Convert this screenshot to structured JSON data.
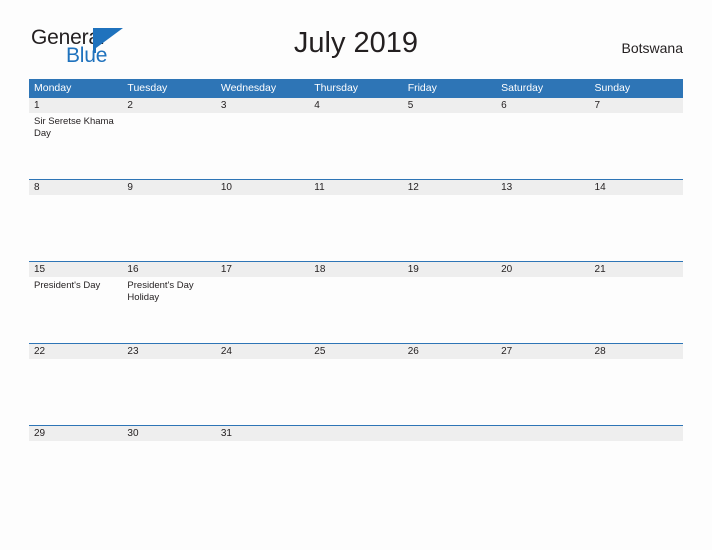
{
  "brand": {
    "name_part1": "General",
    "name_part2": "Blue",
    "flag_icon": "blue-triangle-flag-icon",
    "accent_color": "#1f72bd"
  },
  "header": {
    "title": "July 2019",
    "country": "Botswana"
  },
  "theme": {
    "header_blue": "#2e75b6",
    "number_band": "#eeeeee",
    "cell_background": "#fdfdfd",
    "text_color": "#231f20"
  },
  "calendar": {
    "month": "July",
    "year": "2019",
    "weekday_headers": [
      "Monday",
      "Tuesday",
      "Wednesday",
      "Thursday",
      "Friday",
      "Saturday",
      "Sunday"
    ],
    "weeks": [
      {
        "days": [
          {
            "number": "1",
            "events": [
              "Sir Seretse Khama Day"
            ]
          },
          {
            "number": "2",
            "events": []
          },
          {
            "number": "3",
            "events": []
          },
          {
            "number": "4",
            "events": []
          },
          {
            "number": "5",
            "events": []
          },
          {
            "number": "6",
            "events": []
          },
          {
            "number": "7",
            "events": []
          }
        ]
      },
      {
        "days": [
          {
            "number": "8",
            "events": []
          },
          {
            "number": "9",
            "events": []
          },
          {
            "number": "10",
            "events": []
          },
          {
            "number": "11",
            "events": []
          },
          {
            "number": "12",
            "events": []
          },
          {
            "number": "13",
            "events": []
          },
          {
            "number": "14",
            "events": []
          }
        ]
      },
      {
        "days": [
          {
            "number": "15",
            "events": [
              "President's Day"
            ]
          },
          {
            "number": "16",
            "events": [
              "President's Day Holiday"
            ]
          },
          {
            "number": "17",
            "events": []
          },
          {
            "number": "18",
            "events": []
          },
          {
            "number": "19",
            "events": []
          },
          {
            "number": "20",
            "events": []
          },
          {
            "number": "21",
            "events": []
          }
        ]
      },
      {
        "days": [
          {
            "number": "22",
            "events": []
          },
          {
            "number": "23",
            "events": []
          },
          {
            "number": "24",
            "events": []
          },
          {
            "number": "25",
            "events": []
          },
          {
            "number": "26",
            "events": []
          },
          {
            "number": "27",
            "events": []
          },
          {
            "number": "28",
            "events": []
          }
        ]
      },
      {
        "days": [
          {
            "number": "29",
            "events": []
          },
          {
            "number": "30",
            "events": []
          },
          {
            "number": "31",
            "events": []
          },
          {
            "number": "",
            "events": []
          },
          {
            "number": "",
            "events": []
          },
          {
            "number": "",
            "events": []
          },
          {
            "number": "",
            "events": []
          }
        ]
      }
    ]
  }
}
